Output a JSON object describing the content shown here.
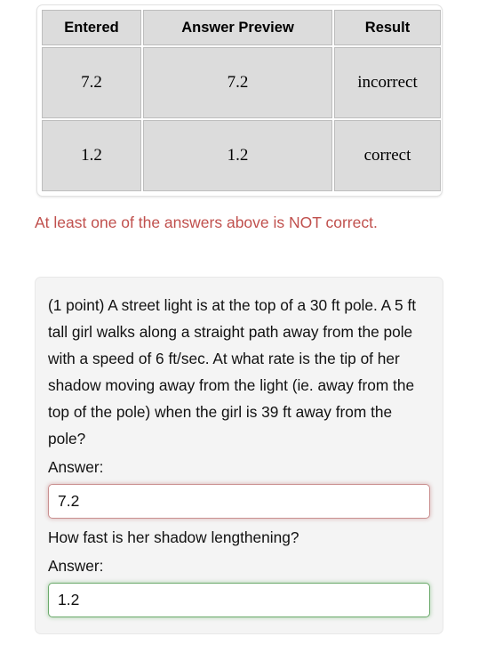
{
  "results_table": {
    "headers": [
      "Entered",
      "Answer Preview",
      "Result"
    ],
    "rows": [
      {
        "entered": "7.2",
        "preview": "7.2",
        "result": "incorrect",
        "state": "incorrect"
      },
      {
        "entered": "1.2",
        "preview": "1.2",
        "result": "correct",
        "state": "correct"
      }
    ],
    "colors": {
      "incorrect_bg": "#cc8f8f",
      "correct_bg": "#7ef47e",
      "result_text": "#1b1f6b",
      "cell_bg": "#dcdcdc"
    }
  },
  "warning": {
    "text": "At least one of the answers above is NOT correct.",
    "color": "#c0504d"
  },
  "problem": {
    "statement": "(1 point) A street light is at the top of a 30 ft pole. A 5 ft tall girl walks along a straight path away from the pole with a speed of 6 ft/sec. At what rate is the tip of her shadow moving away from the light (ie. away from the top of the pole) when the girl is 39 ft away from the pole?",
    "answer_label_1": "Answer:",
    "answer_value_1": "7.2",
    "followup_question": "How fast is her shadow lengthening?",
    "answer_label_2": "Answer:",
    "answer_value_2": "1.2"
  }
}
